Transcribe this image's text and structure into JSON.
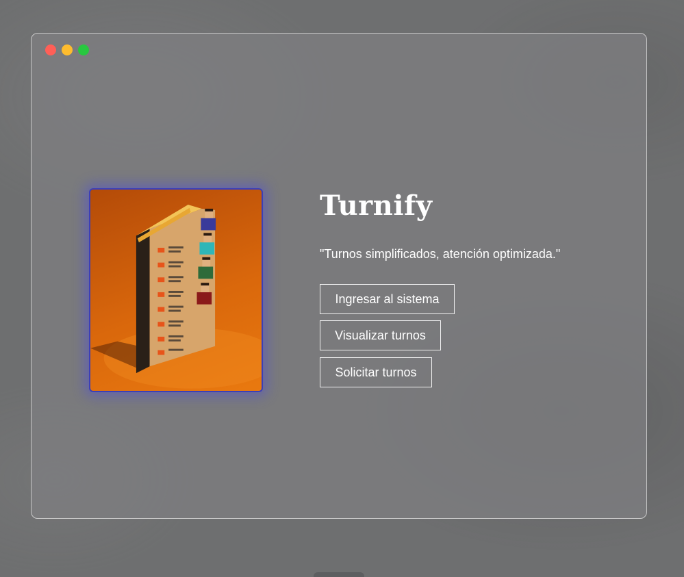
{
  "window": {
    "controls": [
      "close",
      "minimize",
      "zoom"
    ]
  },
  "hero": {
    "image_name": "queue-list-illustration"
  },
  "main": {
    "title": "Turnify",
    "tagline": "\"Turnos simplificados, atención optimizada.\"",
    "buttons": {
      "login": "Ingresar al sistema",
      "view": "Visualizar turnos",
      "request": "Solicitar turnos"
    }
  },
  "colors": {
    "accent_border": "#3b3fb8",
    "close": "#ff5f57",
    "minimize": "#febc2e",
    "zoom": "#28c840"
  }
}
